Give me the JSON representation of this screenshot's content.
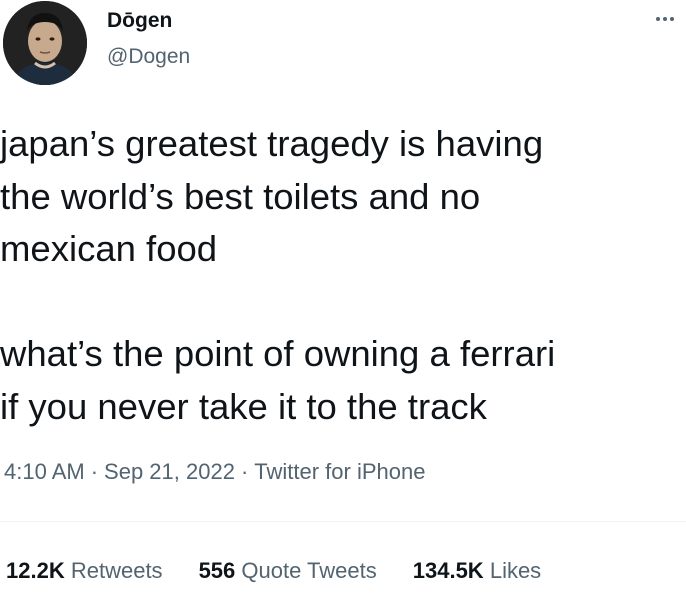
{
  "author": {
    "name": "Dōgen",
    "handle": "@Dogen",
    "avatar_icon": "profile-photo"
  },
  "more_icon": "more-horizontal-icon",
  "tweet": {
    "paragraphs": [
      [
        "japan’s greatest tragedy is having",
        "the world’s best toilets and no",
        "mexican food"
      ],
      [
        "what’s the point of owning a ferrari",
        "if you never take it to the track"
      ]
    ]
  },
  "meta": {
    "time": "4:10 AM",
    "separator": "·",
    "date": "Sep 21, 2022",
    "source": "Twitter for iPhone"
  },
  "stats": {
    "retweets": {
      "count": "12.2K",
      "label": "Retweets"
    },
    "quotes": {
      "count": "556",
      "label": "Quote Tweets"
    },
    "likes": {
      "count": "134.5K",
      "label": "Likes"
    }
  },
  "colors": {
    "text_primary": "#0f1419",
    "text_secondary": "#536471",
    "divider": "#eff3f4",
    "background": "#ffffff"
  }
}
